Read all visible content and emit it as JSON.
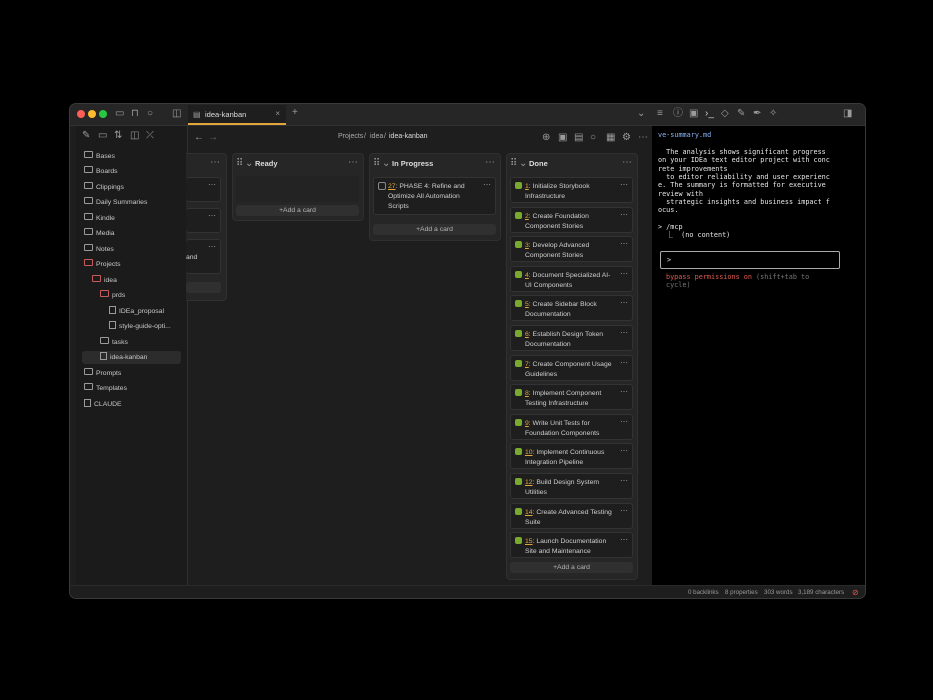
{
  "tab": {
    "title": "idea-kanban",
    "close": "×",
    "new": "+"
  },
  "sidebar": {
    "items": [
      {
        "label": "Bases",
        "type": "folder"
      },
      {
        "label": "Boards",
        "type": "folder"
      },
      {
        "label": "Clippings",
        "type": "folder"
      },
      {
        "label": "Daily Summaries",
        "type": "folder"
      },
      {
        "label": "Kindle",
        "type": "folder"
      },
      {
        "label": "Media",
        "type": "folder"
      },
      {
        "label": "Notes",
        "type": "folder"
      },
      {
        "label": "Projects",
        "type": "folder-open"
      },
      {
        "label": "idea",
        "type": "folder-open"
      },
      {
        "label": "prds",
        "type": "folder-open"
      },
      {
        "label": "IDEa_proposal",
        "type": "file"
      },
      {
        "label": "style-guide-opti...",
        "type": "file"
      },
      {
        "label": "tasks",
        "type": "folder"
      },
      {
        "label": "idea-kanban",
        "type": "file",
        "selected": true
      },
      {
        "label": "Prompts",
        "type": "folder"
      },
      {
        "label": "Templates",
        "type": "folder"
      },
      {
        "label": "CLAUDE",
        "type": "file"
      }
    ]
  },
  "breadcrumb": {
    "p1": "Projects",
    "sep1": "/",
    "p2": "idea",
    "sep2": "/",
    "p3": "idea-kanban"
  },
  "kanban": {
    "partial_card_text": "and",
    "ready": {
      "title": "Ready",
      "add": "+Add a card"
    },
    "in_progress": {
      "title": "In Progress",
      "add": "+Add a card",
      "cards": [
        {
          "num": "27",
          "text": ": PHASE 4: Refine and Optimize All Automation Scripts"
        }
      ]
    },
    "done": {
      "title": "Done",
      "add": "+Add a card",
      "cards": [
        {
          "num": "1",
          "l1": ": Initialize Storybook",
          "l2": "Infrastructure"
        },
        {
          "num": "2",
          "l1": ": Create Foundation",
          "l2": "Component Stories"
        },
        {
          "num": "3",
          "l1": ": Develop Advanced",
          "l2": "Component Stories"
        },
        {
          "num": "4",
          "l1": ": Document Specialized AI-",
          "l2": "UI Components"
        },
        {
          "num": "5",
          "l1": ": Create Sidebar Block",
          "l2": "Documentation"
        },
        {
          "num": "6",
          "l1": ": Establish Design Token",
          "l2": "Documentation"
        },
        {
          "num": "7",
          "l1": ": Create Component Usage",
          "l2": "Guidelines"
        },
        {
          "num": "8",
          "l1": ": Implement Component",
          "l2": "Testing Infrastructure"
        },
        {
          "num": "9",
          "l1": ": Write Unit Tests for",
          "l2": "Foundation Components"
        },
        {
          "num": "10",
          "l1": ": Implement Continuous",
          "l2": "Integration Pipeline"
        },
        {
          "num": "12",
          "l1": ": Build Design System",
          "l2": "Utilities"
        },
        {
          "num": "14",
          "l1": ": Create Advanced Testing",
          "l2": "Suite"
        },
        {
          "num": "15",
          "l1": ": Launch Documentation",
          "l2": "Site and Maintenance"
        }
      ]
    }
  },
  "terminal": {
    "filename": "ve-summary.md",
    "lines": [
      "  The analysis shows significant progress",
      "on your IDEa text editor project with conc",
      "rete improvements",
      "  to editor reliability and user experienc",
      "e. The summary is formatted for executive",
      "review with",
      "  strategic insights and business impact f",
      "ocus."
    ],
    "mcp": "> /mcp",
    "no_content": "  ⎿  (no content)",
    "prompt": ">",
    "bypass": "bypass permissions on",
    "bypass_hint": " (shift+tab to",
    "bypass_hint2": "cycle)"
  },
  "status": {
    "backlinks": "0 backlinks",
    "properties": "8 properties",
    "words": "303 words",
    "characters": "3,189 characters"
  },
  "colors": {
    "accent": "#e0a63b",
    "check": "#7aa92f",
    "warning": "#e05a4f"
  }
}
